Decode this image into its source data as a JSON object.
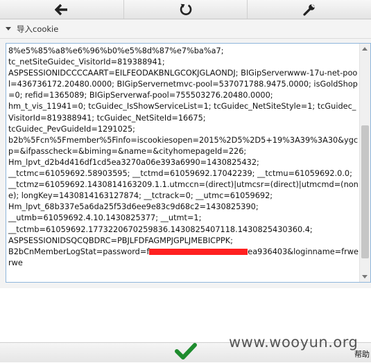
{
  "toolbar": {
    "back_icon": "arrow-left-icon",
    "refresh_icon": "refresh-icon",
    "settings_icon": "wrench-icon"
  },
  "section": {
    "title": "导入cookie"
  },
  "cookie": {
    "text_before_redaction": "8%e5%85%a8%e6%96%b0%e5%8d%87%e7%ba%a7;\ntc_netSiteGuidec_VisitorId=819388941;\nASPSESSIONIDCCCCAART=EILFEODAKBNLGCOKJGLAONDJ; BIGipServerwww-17u-net-pool=436736172.20480.0000; BIGipServernetmvc-pool=537071788.9475.0000; isGoldShop=0; refid=1365089; BIGipServerwaf-pool=755503276.20480.0000;\nhm_t_vis_11941=0; tcGuidec_IsShowServiceList=1; tcGuidec_NetSiteStyle=1; tcGuidec_VisitorId=819388941; tcGuidec_NetSiteId=16675;\ntcGuidec_PevGuideId=1291025;\nb2b%5Fcn%5Fmember%5Finfo=iscookiesopen=2015%2D5%2D5+19%3A39%3A30&ygcp=&ifpasscheck=&biming=&name=&cityhomepageId=226;\nHm_lpvt_d2b4d416df1cd5ea3270a06e393a6990=1430825432;\n__tctmc=61059692.58903595; __tctmd=61059692.17042239; __tctmu=61059692.0.0;\n__tctmz=61059692.1430814163209.1.1.utmccn=(direct)|utmcsr=(direct)|utmcmd=(none); longKey=1430814163127874; __tctrack=0; __utmc=61059692;\nHm_lpvt_68b337e5a6da25f53d6ee9e83c9d68c2=1430825390;\n__utmb=61059692.4.10.1430825377; __utmt=1;\n__tctmb=61059692.1773220670259836.1430825407118.1430825430360.4;\nASPSESSIONIDSQCQBDRC=PBJLFDFAGMPJGPLJMEBICPPK;\nB2bCnMemberLogStat=password=f",
    "text_after_redaction": "ea936403&loginname=frwerwe"
  },
  "footer": {
    "confirm_icon": "checkmark-icon"
  },
  "watermark": {
    "text": "www.wooyun.org"
  },
  "corner": {
    "label": "帮助"
  }
}
